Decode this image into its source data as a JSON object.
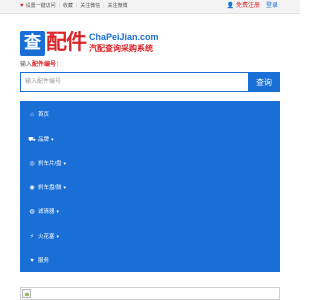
{
  "topbar": {
    "links": [
      "设置一键访问",
      "收藏",
      "关注微信",
      "关注微博"
    ],
    "register": "免费注册",
    "login": "登录",
    "icon_left": "heart-icon",
    "icon_right": "user-icon"
  },
  "logo": {
    "mark": "查",
    "name": "配件",
    "domain": "ChaPeiJian.com",
    "slogan": "汽配查询采购系统"
  },
  "search": {
    "hint_prefix": "输入",
    "hint_highlight": "配件编号",
    "hint_suffix": "：",
    "placeholder": "输入配件编号",
    "button": "查询"
  },
  "menu": {
    "items": [
      {
        "label": "首页",
        "icon": "home-icon",
        "glyph": "⌂",
        "dropdown": false
      },
      {
        "label": "品牌",
        "icon": "car-icon",
        "glyph": "⛟",
        "dropdown": true
      },
      {
        "label": "刹车片/盘",
        "icon": "brake-icon",
        "glyph": "◎",
        "dropdown": true
      },
      {
        "label": "刹车盘/鼓",
        "icon": "disc-icon",
        "glyph": "◉",
        "dropdown": true
      },
      {
        "label": "滤清器",
        "icon": "filter-icon",
        "glyph": "◍",
        "dropdown": true
      },
      {
        "label": "火花塞",
        "icon": "spark-plug-icon",
        "glyph": "⚡",
        "dropdown": true
      },
      {
        "label": "服务",
        "icon": "heart-icon",
        "glyph": "♥",
        "dropdown": false
      }
    ]
  },
  "colors": {
    "brand_blue": "#1a6fd6",
    "brand_red": "#d9262b"
  }
}
